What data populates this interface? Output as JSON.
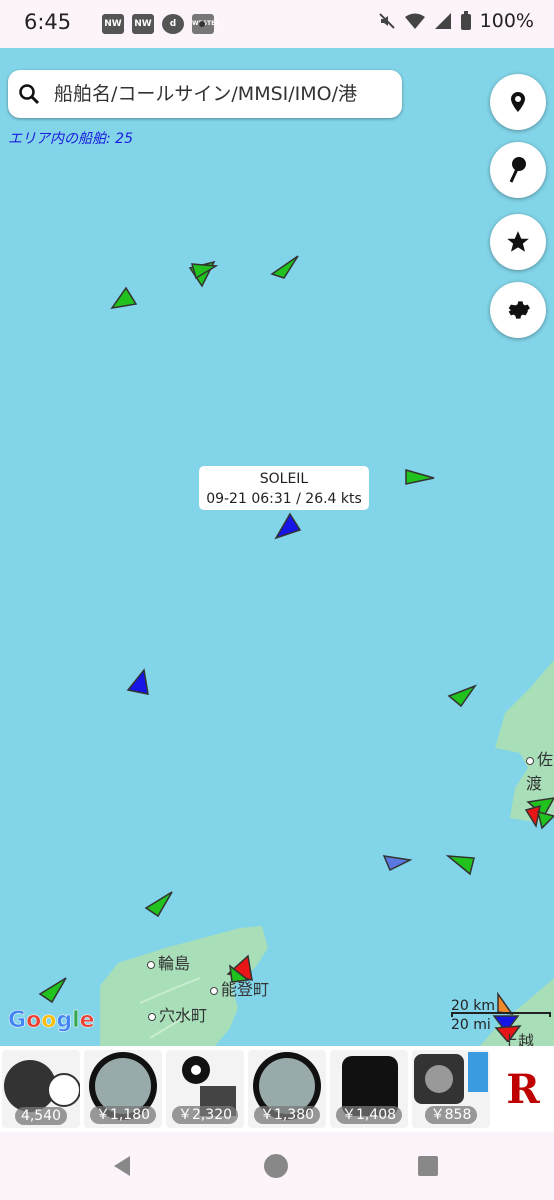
{
  "status_bar": {
    "time": "6:45",
    "battery": "100%"
  },
  "search": {
    "placeholder": "船舶名/コールサイン/MMSI/IMO/港"
  },
  "ship_count": "エリア内の船舶: 25",
  "tooltip": {
    "name": "SOLEIL",
    "details": "09-21 06:31 / 26.4 kts"
  },
  "places": {
    "sado": "佐渡",
    "wajima": "輪島",
    "noto": "能登町",
    "anamizu": "穴水町",
    "joetsu": "上越"
  },
  "scale": {
    "km": "20 km",
    "mi": "20 mi"
  },
  "google_logo": "Google",
  "ad_prices": [
    "4,540",
    "￥1,180",
    "￥2,320",
    "￥1,380",
    "￥1,408",
    "￥858"
  ],
  "ad_brand": "R",
  "colors": {
    "water": "#82d4e8",
    "land": "#a8dfb9",
    "cargo": "#21c11e",
    "passenger": "#1515e6",
    "tanker": "#e81616",
    "search_text_count": "#1a1adf"
  },
  "icons": [
    "search-icon",
    "location-pin-icon",
    "map-pin-icon",
    "star-icon",
    "gear-icon",
    "info-icon",
    "back-icon",
    "home-icon",
    "recents-icon"
  ]
}
